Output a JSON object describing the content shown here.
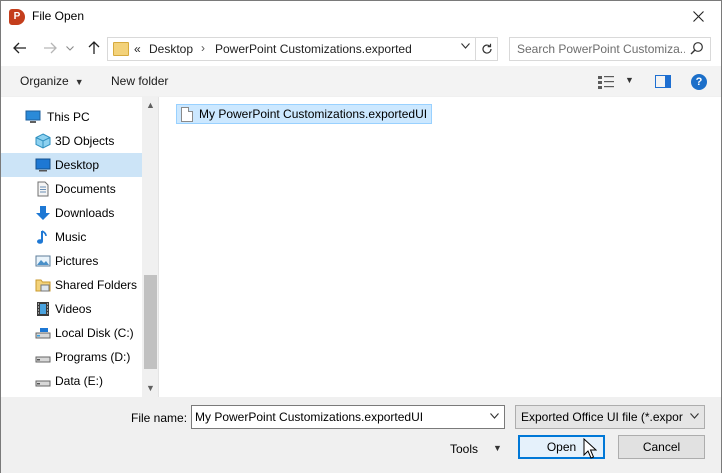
{
  "window": {
    "title": "File Open",
    "app_icon_letter": "P"
  },
  "nav": {
    "address": {
      "overflow": "«",
      "crumbs": [
        "Desktop",
        "PowerPoint Customizations.exported"
      ],
      "separator": "›"
    },
    "search_placeholder": "Search PowerPoint Customiza..."
  },
  "commands": {
    "organize": "Organize",
    "new_folder": "New folder"
  },
  "sidebar": {
    "items": [
      {
        "label": "This PC",
        "icon": "pc-icon"
      },
      {
        "label": "3D Objects",
        "icon": "cube-icon"
      },
      {
        "label": "Desktop",
        "icon": "desktop-icon",
        "selected": true
      },
      {
        "label": "Documents",
        "icon": "document-icon"
      },
      {
        "label": "Downloads",
        "icon": "download-arrow-icon"
      },
      {
        "label": "Music",
        "icon": "music-note-icon"
      },
      {
        "label": "Pictures",
        "icon": "picture-icon"
      },
      {
        "label": "Shared Folders",
        "icon": "shared-folder-icon"
      },
      {
        "label": "Videos",
        "icon": "video-icon"
      },
      {
        "label": "Local Disk (C:)",
        "icon": "disk-icon"
      },
      {
        "label": "Programs (D:)",
        "icon": "disk-icon"
      },
      {
        "label": "Data (E:)",
        "icon": "disk-icon"
      }
    ]
  },
  "files": [
    {
      "name": "My PowerPoint Customizations.exportedUI",
      "selected": true
    }
  ],
  "bottom": {
    "file_name_label": "File name:",
    "file_name_value": "My PowerPoint Customizations.exportedUI",
    "file_type_value": "Exported Office UI file (*.exportedUI)",
    "tools_label": "Tools",
    "open_label": "Open",
    "cancel_label": "Cancel"
  },
  "colors": {
    "accent": "#0078d7",
    "selection": "#cce8ff",
    "nav_selection": "#cce4f7",
    "help": "#1c6fc9",
    "app": "#c43e1c"
  }
}
